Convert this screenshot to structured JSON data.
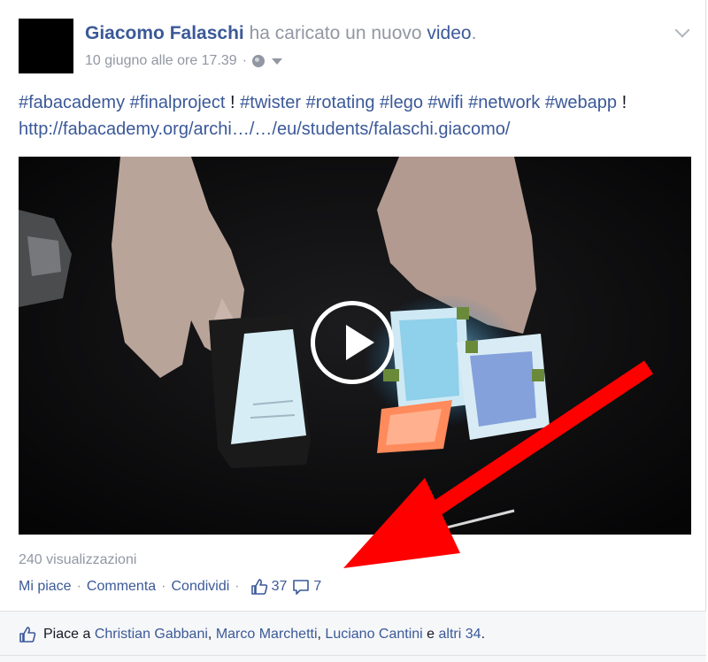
{
  "post": {
    "author": "Giacomo Falaschi",
    "action_text": "ha caricato un nuovo",
    "object_link": "video",
    "object_period": ".",
    "timestamp": "10 giugno alle ore 17.39",
    "timestamp_sep": "·",
    "privacy_icon": "globe-icon",
    "menu_icon": "chevron-down-icon"
  },
  "message": {
    "hashtags": [
      "#fabacademy",
      "#finalproject"
    ],
    "bang1": "!",
    "hashtags2": [
      "#twister",
      "#rotating",
      "#lego",
      "#wifi",
      "#network",
      "#webapp"
    ],
    "bang2": "!",
    "url": "http://fabacademy.org/archi…/…/eu/students/falaschi.giacomo/"
  },
  "video": {
    "play_icon": "play-icon"
  },
  "stats": {
    "views": "240 visualizzazioni",
    "like_label": "Mi piace",
    "comment_label": "Commenta",
    "share_label": "Condividi",
    "sep": "·",
    "like_count": "37",
    "comment_count": "7"
  },
  "likes": {
    "prefix": "Piace a",
    "people": [
      "Christian Gabbani",
      "Marco Marchetti",
      "Luciano Cantini"
    ],
    "comma": ",",
    "conj": "e",
    "others": "altri 34",
    "end": "."
  },
  "colors": {
    "link": "#3b5998",
    "muted": "#9197a3",
    "annotation_arrow": "#ff0000"
  }
}
